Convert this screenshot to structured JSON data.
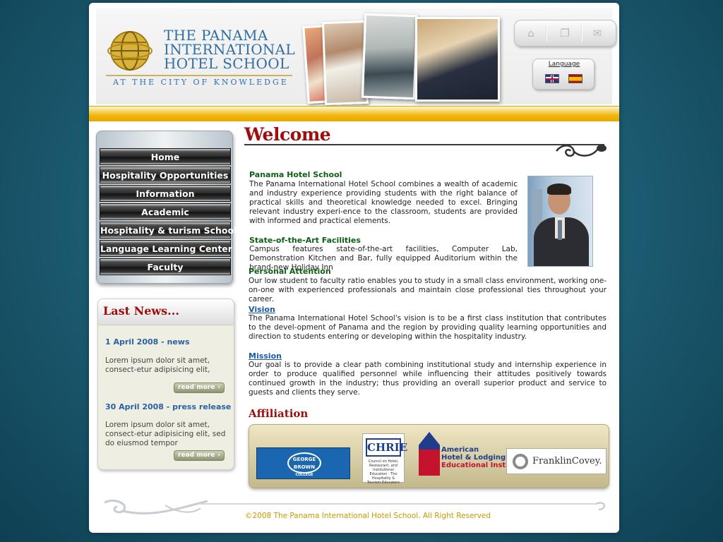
{
  "header": {
    "school_name_lines": [
      "THE PANAMA",
      "INTERNATIONAL",
      "HOTEL SCHOOL"
    ],
    "tagline": "AT THE CITY OF KNOWLEDGE",
    "language_label": "Language",
    "icons": {
      "home": "home-icon",
      "pages": "pages-icon",
      "mail": "mail-icon"
    }
  },
  "nav": {
    "items": [
      {
        "label": "Home"
      },
      {
        "label": "Hospitality Opportunities"
      },
      {
        "label": "Information"
      },
      {
        "label": "Academic"
      },
      {
        "label": "Hospitality & turism School"
      },
      {
        "label": "Language Learning Center"
      },
      {
        "label": "Faculty"
      }
    ]
  },
  "news": {
    "title": "Last News...",
    "items": [
      {
        "date": "1 April 2008 - news",
        "text": "Lorem ipsum dolor sit amet, consect-etur adipisicing elit,",
        "read_more": "read more"
      },
      {
        "date": "30 April 2008 - press release",
        "text": "Lorem ipsum dolor sit amet, consect-etur adipisicing elit, sed do eiusmod tempor",
        "read_more": "read more"
      }
    ]
  },
  "main": {
    "welcome": "Welcome",
    "sections": [
      {
        "title": "Panama Hotel School",
        "text": "The Panama International Hotel School combines a wealth of academic and industry experience providing students with the right balance of practical skills and theoretical knowledge needed to excel. Bringing relevant industry experi-ence to the classroom, students are provided with informed and practical elements."
      },
      {
        "title": "State-of-the-Art Facilities",
        "text": "Campus features state-of-the-art facilities, Computer Lab, Demonstration Kitchen and Bar, fully equipped Auditorium within the brand-new Holiday Inn"
      },
      {
        "title": "Personal Attention",
        "text": "Our low student to faculty ratio enables you to study in a small class environment, working one-on-one with experienced professionals and maintain close professional ties throughout your career."
      },
      {
        "title": "Vision",
        "text": "The Panama International Hotel School's vision is to be a first class institution that contributes to the devel-opment of Panama and the region by providing quality learning opportunities and direction to students entering or developing within the hospitality industry."
      },
      {
        "title": "Mission",
        "text": "Our goal is to provide a clear path combining institutional study and internship experience in order to produce qualified personnel while influencing their attitudes positively towards continued growth in the industry; thus providing an overall superior product and service to guests and clients they serve."
      }
    ],
    "affiliation_title": "Affiliation",
    "affiliations": {
      "george_brown": [
        "GEORGE",
        "BROWN",
        "COLLEGE"
      ],
      "chrie": {
        "big": "CHRIE",
        "small": "Council on Hotel, Restaurant, and Institutional Education · The Hospitality & Tourism Educators"
      },
      "ahla": [
        "American",
        "Hotel & Lodging",
        "Educational Institute"
      ],
      "franklin": "FranklinCovey."
    }
  },
  "footer": {
    "copyright": "©2008 The Panama International Hotel School. All Right Reserved"
  },
  "colors": {
    "accent_red": "#a10c0c",
    "section_green": "#0d5f14",
    "link_blue": "#1a5aa3",
    "gold": "#f0b60a",
    "background_teal": "#1b5a70"
  }
}
